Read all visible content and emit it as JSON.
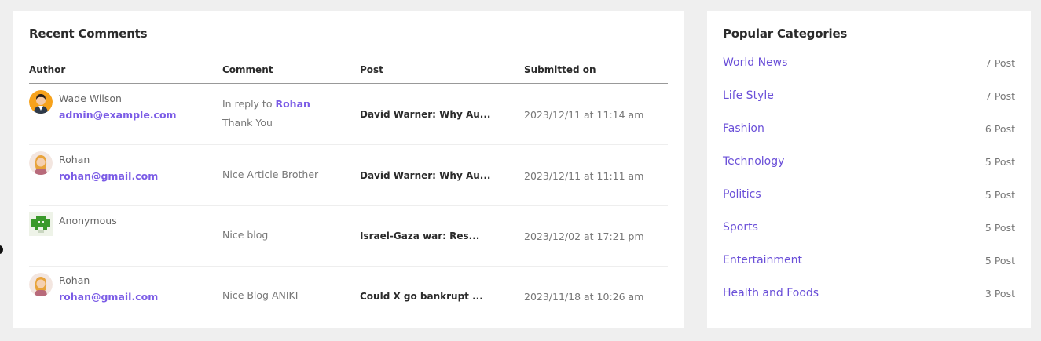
{
  "recent_comments": {
    "title": "Recent Comments",
    "headers": {
      "author": "Author",
      "comment": "Comment",
      "post": "Post",
      "submitted": "Submitted on"
    },
    "rows": [
      {
        "avatar_icon": "user-avatar-male-orange-icon",
        "author": "Wade Wilson",
        "email": "admin@example.com",
        "reply_prefix": "In reply to",
        "reply_to": "Rohan",
        "comment": "Thank You",
        "post": "David Warner: Why Au...",
        "submitted": "2023/12/11 at 11:14 am"
      },
      {
        "avatar_icon": "user-avatar-female-icon",
        "author": "Rohan",
        "email": "rohan@gmail.com",
        "comment": "Nice Article Brother",
        "post": "David Warner: Why Au...",
        "submitted": "2023/12/11 at 11:11 am"
      },
      {
        "avatar_icon": "identicon-green-icon",
        "author": "Anonymous",
        "email": "",
        "comment": "Nice blog",
        "post": "Israel-Gaza war: Res...",
        "submitted": "2023/12/02 at 17:21 pm"
      },
      {
        "avatar_icon": "user-avatar-female-icon",
        "author": "Rohan",
        "email": "rohan@gmail.com",
        "comment": "Nice Blog ANIKI",
        "post": "Could X go bankrupt ...",
        "submitted": "2023/11/18 at 10:26 am"
      }
    ]
  },
  "popular_categories": {
    "title": "Popular Categories",
    "items": [
      {
        "name": "World News",
        "count": "7 Post"
      },
      {
        "name": "Life Style",
        "count": "7 Post"
      },
      {
        "name": "Fashion",
        "count": "6 Post"
      },
      {
        "name": "Technology",
        "count": "5 Post"
      },
      {
        "name": "Politics",
        "count": "5 Post"
      },
      {
        "name": "Sports",
        "count": "5 Post"
      },
      {
        "name": "Entertainment",
        "count": "5 Post"
      },
      {
        "name": "Health and Foods",
        "count": "3 Post"
      }
    ]
  },
  "colors": {
    "accent": "#7b5ce6",
    "link": "#6a4fd8",
    "background": "#efefef",
    "card": "#ffffff"
  }
}
